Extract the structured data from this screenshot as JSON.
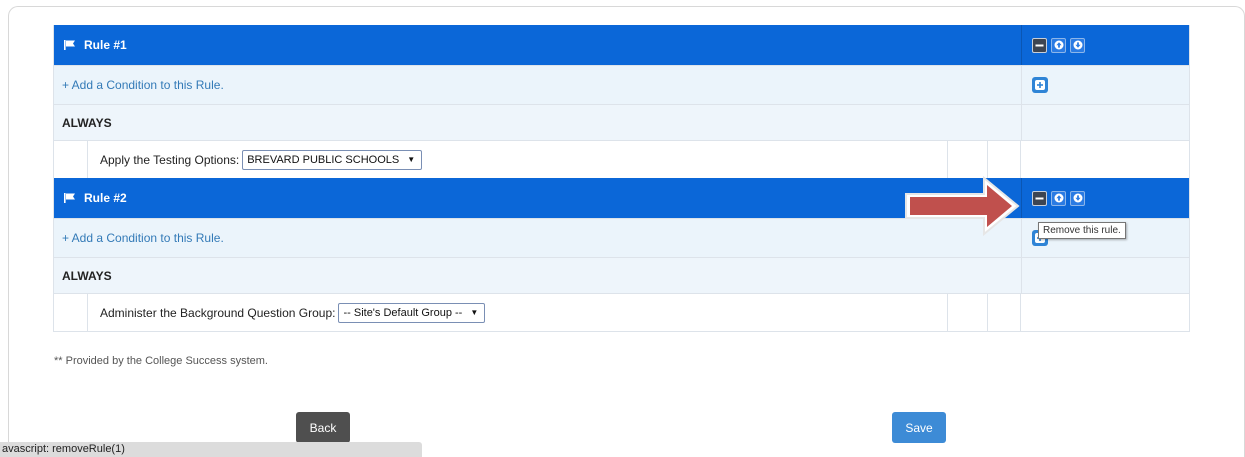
{
  "colors": {
    "rule_header_bg": "#0b67d8",
    "link": "#337ab7",
    "back_button": "#4f4f4f",
    "save_button": "#3d8bd6",
    "arrow": "#c0504d"
  },
  "rules": [
    {
      "title": "Rule #1",
      "add_condition_label": "+ Add a Condition to this Rule.",
      "always_label": "ALWAYS",
      "option_label": "Apply the Testing Options:",
      "option_value": "BREVARD PUBLIC SCHOOLS"
    },
    {
      "title": "Rule #2",
      "add_condition_label": "+ Add a Condition to this Rule.",
      "always_label": "ALWAYS",
      "option_label": "Administer the Background Question Group:",
      "option_value": "-- Site's Default Group --"
    }
  ],
  "controls": {
    "remove_icon": "minus-icon",
    "move_up_icon": "arrow-up-circle-icon",
    "move_down_icon": "arrow-down-circle-icon",
    "add_icon": "plus-icon"
  },
  "tooltip": "Remove this rule.",
  "note": "** Provided by the College Success system.",
  "buttons": {
    "back": "Back",
    "save": "Save"
  },
  "status_bar": "avascript: removeRule(1)"
}
